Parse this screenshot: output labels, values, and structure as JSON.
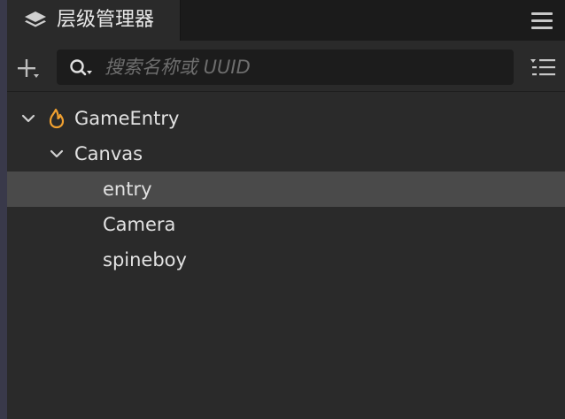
{
  "panel": {
    "title": "层级管理器"
  },
  "search": {
    "placeholder": "搜索名称或 UUID",
    "value": ""
  },
  "tree": {
    "root": {
      "label": "GameEntry",
      "expanded": true,
      "icon": "flame-icon"
    },
    "canvas": {
      "label": "Canvas",
      "expanded": true
    },
    "children": [
      {
        "label": "entry",
        "selected": true
      },
      {
        "label": "Camera",
        "selected": false
      },
      {
        "label": "spineboy",
        "selected": false
      }
    ]
  },
  "colors": {
    "accent_flame": "#f0a030",
    "selected_row": "#4a4a4a",
    "background": "#2a2a2a"
  }
}
